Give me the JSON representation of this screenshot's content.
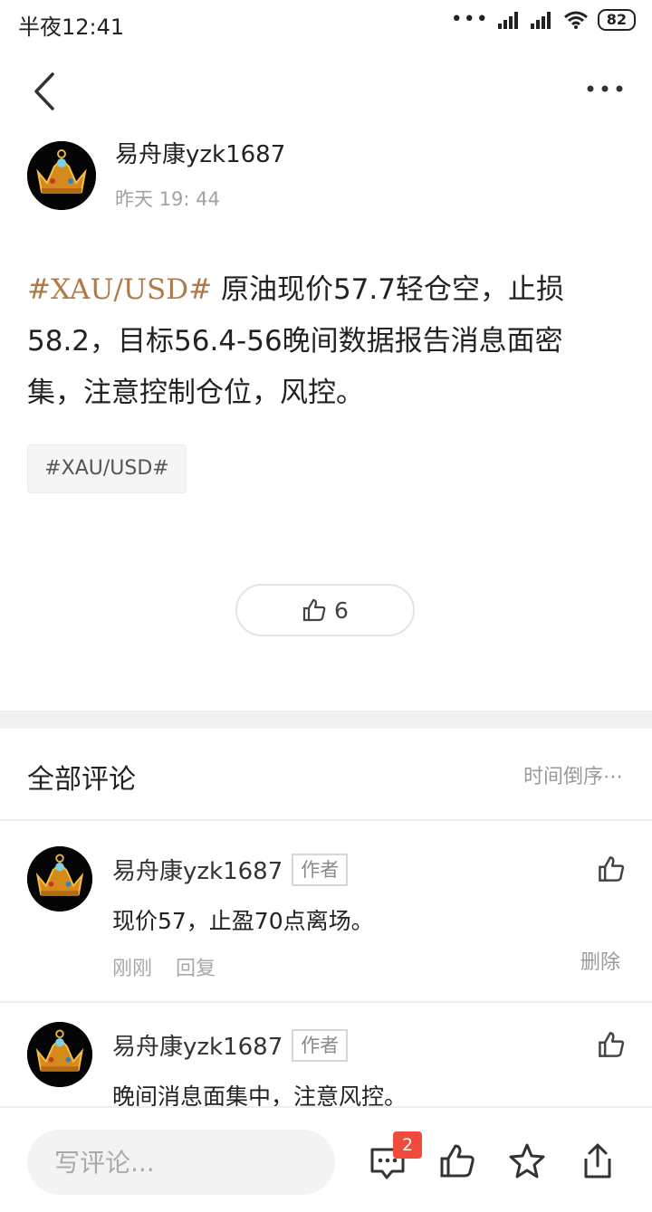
{
  "status_bar": {
    "time": "半夜12:41",
    "battery": "82",
    "icons": [
      "dots-icon",
      "signal-icon",
      "signal-icon",
      "wifi-icon",
      "battery-icon"
    ]
  },
  "nav": {
    "back_icon": "chevron-left-icon",
    "more_icon": "more-horizontal-icon"
  },
  "post": {
    "author": "易舟康yzk1687",
    "time": "昨天 19: 44",
    "hashtag": "#XAU/USD#",
    "body": " 原油现价57.7轻仓空，止损58.2，目标56.4-56晚间数据报告消息面密集，注意控制仓位，风控。",
    "tag_chip": "#XAU/USD#",
    "like_count": "6"
  },
  "comments_section": {
    "title": "全部评论",
    "sort_label": "时间倒序",
    "sort_more": "⋯",
    "items": [
      {
        "author": "易舟康yzk1687",
        "badge": "作者",
        "text": "现价57，止盈70点离场。",
        "time": "刚刚",
        "reply": "回复",
        "delete": "删除"
      },
      {
        "author": "易舟康yzk1687",
        "badge": "作者",
        "text": "晚间消息面集中，注意风控。"
      }
    ]
  },
  "bottom_bar": {
    "comment_placeholder": "写评论...",
    "comment_badge": "2",
    "icons": [
      "comment-icon",
      "thumb-up-icon",
      "star-icon",
      "share-icon"
    ]
  },
  "colors": {
    "hashtag": "#b07a48",
    "badge_red": "#f04b3b",
    "muted_text": "#a2a2a2"
  }
}
